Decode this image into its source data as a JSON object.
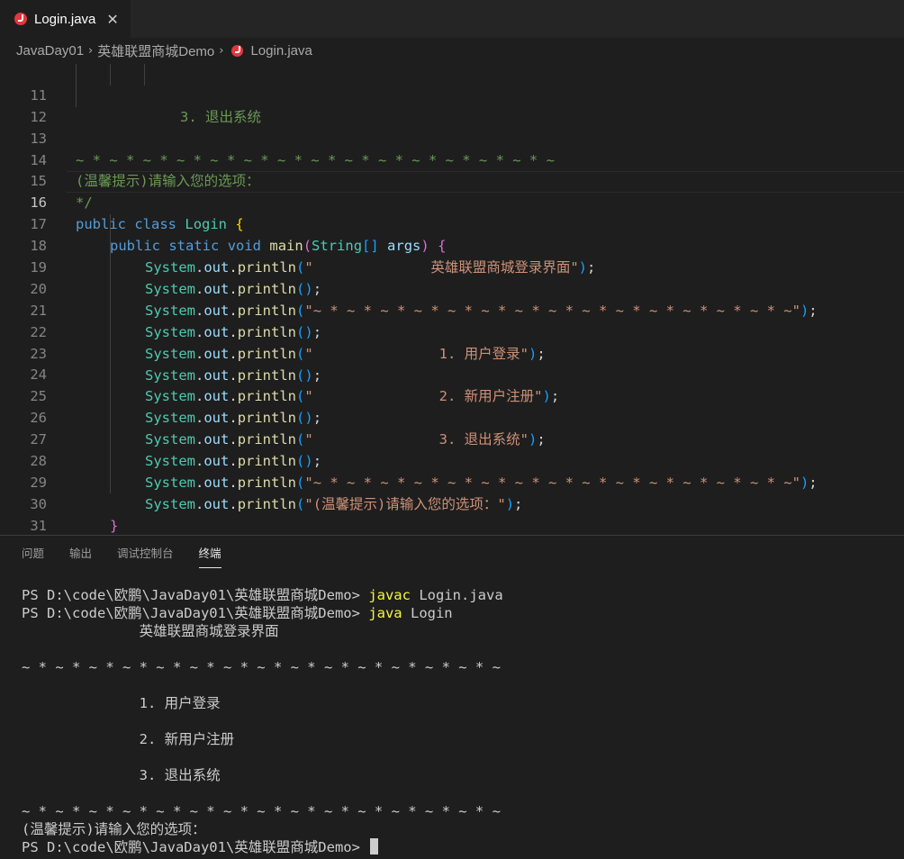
{
  "tab": {
    "label": "Login.java",
    "close": "✕",
    "icon": "java-file-icon"
  },
  "breadcrumb": {
    "items": [
      "JavaDay01",
      "英雄联盟商城Demo",
      "Login.java"
    ],
    "sep": "›"
  },
  "editor": {
    "line_numbers": [
      "11",
      "12",
      "13",
      "14",
      "15",
      "16",
      "17",
      "18",
      "19",
      "20",
      "21",
      "22",
      "23",
      "24",
      "25",
      "26",
      "27",
      "28",
      "29",
      "30",
      "31"
    ],
    "current_line": "16",
    "l11": "3. 退出系统",
    "l13": "~ * ~ * ~ * ~ * ~ * ~ * ~ * ~ * ~ * ~ * ~ * ~ * ~ * ~ * ~",
    "l14": "(温馨提示)请输入您的选项：",
    "l15": "*/",
    "l16": {
      "kw1": "public",
      "kw2": "class",
      "name": "Login",
      "brace": "{"
    },
    "l17": {
      "kw1": "public",
      "kw2": "static",
      "kw3": "void",
      "fn": "main",
      "type": "String",
      "param": "args",
      "brace": "{"
    },
    "sys": "System",
    "dot": ".",
    "out": "out",
    "println": "println",
    "s18": "\"              英雄联盟商城登录界面\"",
    "s20": "\"~ * ~ * ~ * ~ * ~ * ~ * ~ * ~ * ~ * ~ * ~ * ~ * ~ * ~ * ~\"",
    "s22": "\"               1. 用户登录\"",
    "s24": "\"               2. 新用户注册\"",
    "s26": "\"               3. 退出系统\"",
    "s28": "\"~ * ~ * ~ * ~ * ~ * ~ * ~ * ~ * ~ * ~ * ~ * ~ * ~ * ~ * ~\"",
    "s29": "\"(温馨提示)请输入您的选项：\"",
    "close_inner": "}",
    "close_outer": "}"
  },
  "panel": {
    "tabs": [
      "问题",
      "输出",
      "调试控制台",
      "终端"
    ],
    "active_tab": "终端"
  },
  "terminal": {
    "prompt": "PS D:\\code\\欧鹏\\JavaDay01\\英雄联盟商城Demo>",
    "cmd1_name": "javac",
    "cmd1_arg": "Login.java",
    "cmd2_name": "java",
    "cmd2_arg": "Login",
    "out_title": "              英雄联盟商城登录界面",
    "out_sep": "~ * ~ * ~ * ~ * ~ * ~ * ~ * ~ * ~ * ~ * ~ * ~ * ~ * ~ * ~",
    "out_opt1": "              1. 用户登录",
    "out_opt2": "              2. 新用户注册",
    "out_opt3": "              3. 退出系统",
    "out_hint": "(温馨提示)请输入您的选项："
  }
}
